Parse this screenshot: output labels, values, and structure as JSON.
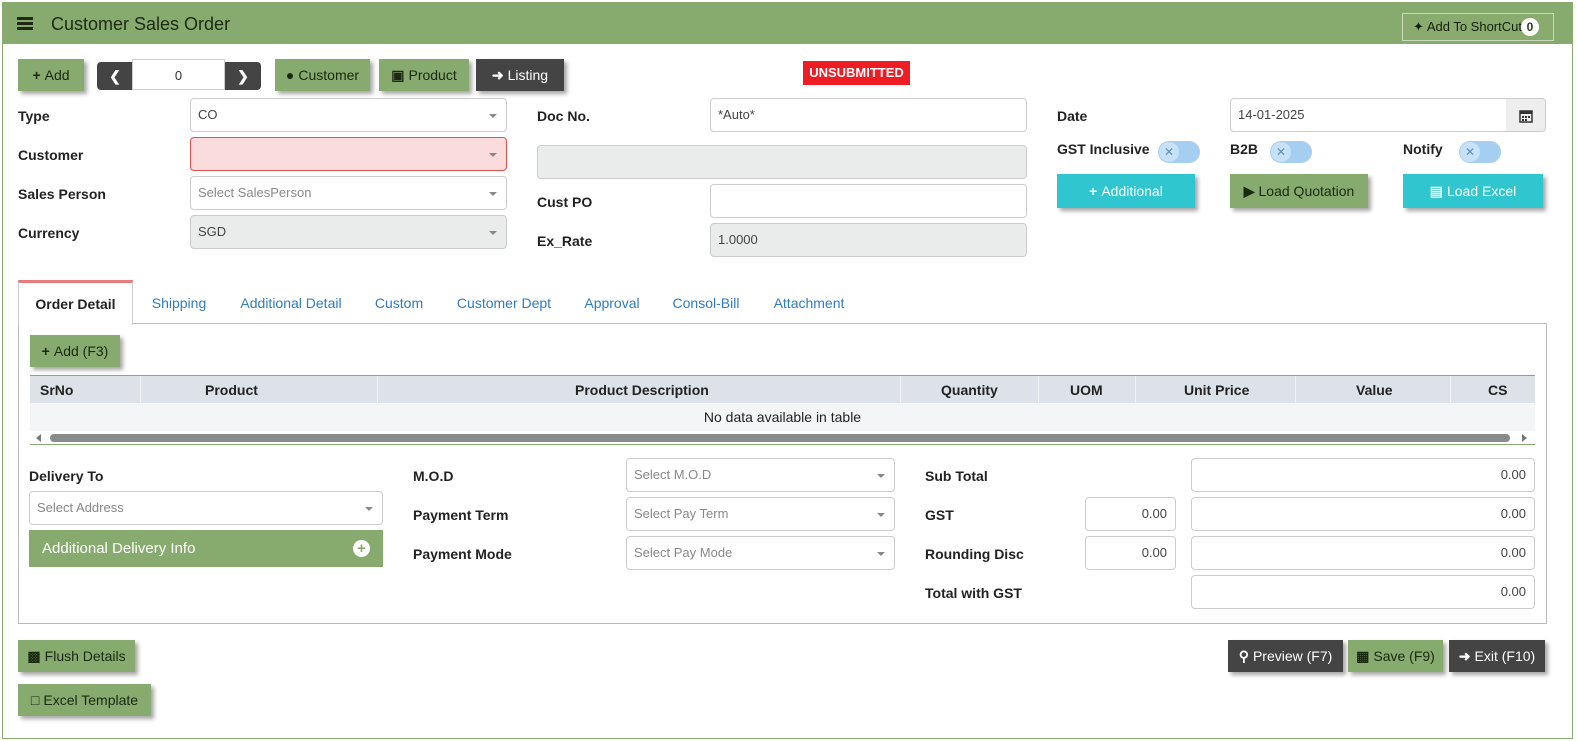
{
  "header": {
    "title": "Customer Sales Order",
    "shortcut_label": "Add To ShortCut",
    "shortcut_count": "0"
  },
  "toolbar": {
    "add_label": "Add",
    "record_number": "0",
    "customer_label": "Customer",
    "product_label": "Product",
    "listing_label": "Listing",
    "status": "UNSUBMITTED"
  },
  "form": {
    "type_label": "Type",
    "type_value": "CO",
    "customer_label": "Customer",
    "customer_value": "",
    "sales_person_label": "Sales Person",
    "sales_person_placeholder": "Select SalesPerson",
    "currency_label": "Currency",
    "currency_value": "SGD",
    "doc_no_label": "Doc No.",
    "doc_no_value": "*Auto*",
    "customer_name_value": "",
    "cust_po_label": "Cust PO",
    "cust_po_value": "",
    "ex_rate_label": "Ex_Rate",
    "ex_rate_value": "1.0000",
    "date_label": "Date",
    "date_value": "14-01-2025",
    "gst_inclusive_label": "GST Inclusive",
    "b2b_label": "B2B",
    "notify_label": "Notify",
    "additional_label": "Additional",
    "load_quotation_label": "Load Quotation",
    "load_excel_label": "Load Excel"
  },
  "tabs": [
    "Order Detail",
    "Shipping",
    "Additional Detail",
    "Custom",
    "Customer Dept",
    "Approval",
    "Consol-Bill",
    "Attachment"
  ],
  "detail": {
    "add_label": "Add (F3)",
    "columns": [
      "SrNo",
      "Product",
      "Product Description",
      "Quantity",
      "UOM",
      "Unit Price",
      "Value",
      "CS"
    ],
    "empty_text": "No data available in table"
  },
  "footer_form": {
    "delivery_to_label": "Delivery To",
    "address_placeholder": "Select Address",
    "additional_delivery_label": "Additional Delivery Info",
    "mod_label": "M.O.D",
    "mod_placeholder": "Select M.O.D",
    "payment_term_label": "Payment Term",
    "payment_term_placeholder": "Select Pay Term",
    "payment_mode_label": "Payment Mode",
    "payment_mode_placeholder": "Select Pay Mode",
    "sub_total_label": "Sub Total",
    "sub_total_value": "0.00",
    "gst_label": "GST",
    "gst_rate": "0.00",
    "gst_value": "0.00",
    "rounding_label": "Rounding Disc",
    "rounding_rate": "0.00",
    "rounding_value": "0.00",
    "total_label": "Total with GST",
    "total_value": "0.00"
  },
  "actions": {
    "flush_label": "Flush Details",
    "excel_template_label": "Excel Template",
    "preview_label": "Preview (F7)",
    "save_label": "Save (F9)",
    "exit_label": "Exit (F10)"
  },
  "colors": {
    "primary": "#87ab6e",
    "dark": "#444444",
    "teal": "#2fc6d0",
    "status": "#ee1c23"
  },
  "icons": [
    "menu-icon",
    "shortcut-icon",
    "plus-icon",
    "chevron-left-icon",
    "chevron-right-icon",
    "user-icon",
    "gift-icon",
    "sign-out-icon",
    "calendar-icon",
    "play-circle-icon",
    "file-excel-icon",
    "search-icon",
    "save-icon",
    "trash-icon",
    "file-icon"
  ]
}
